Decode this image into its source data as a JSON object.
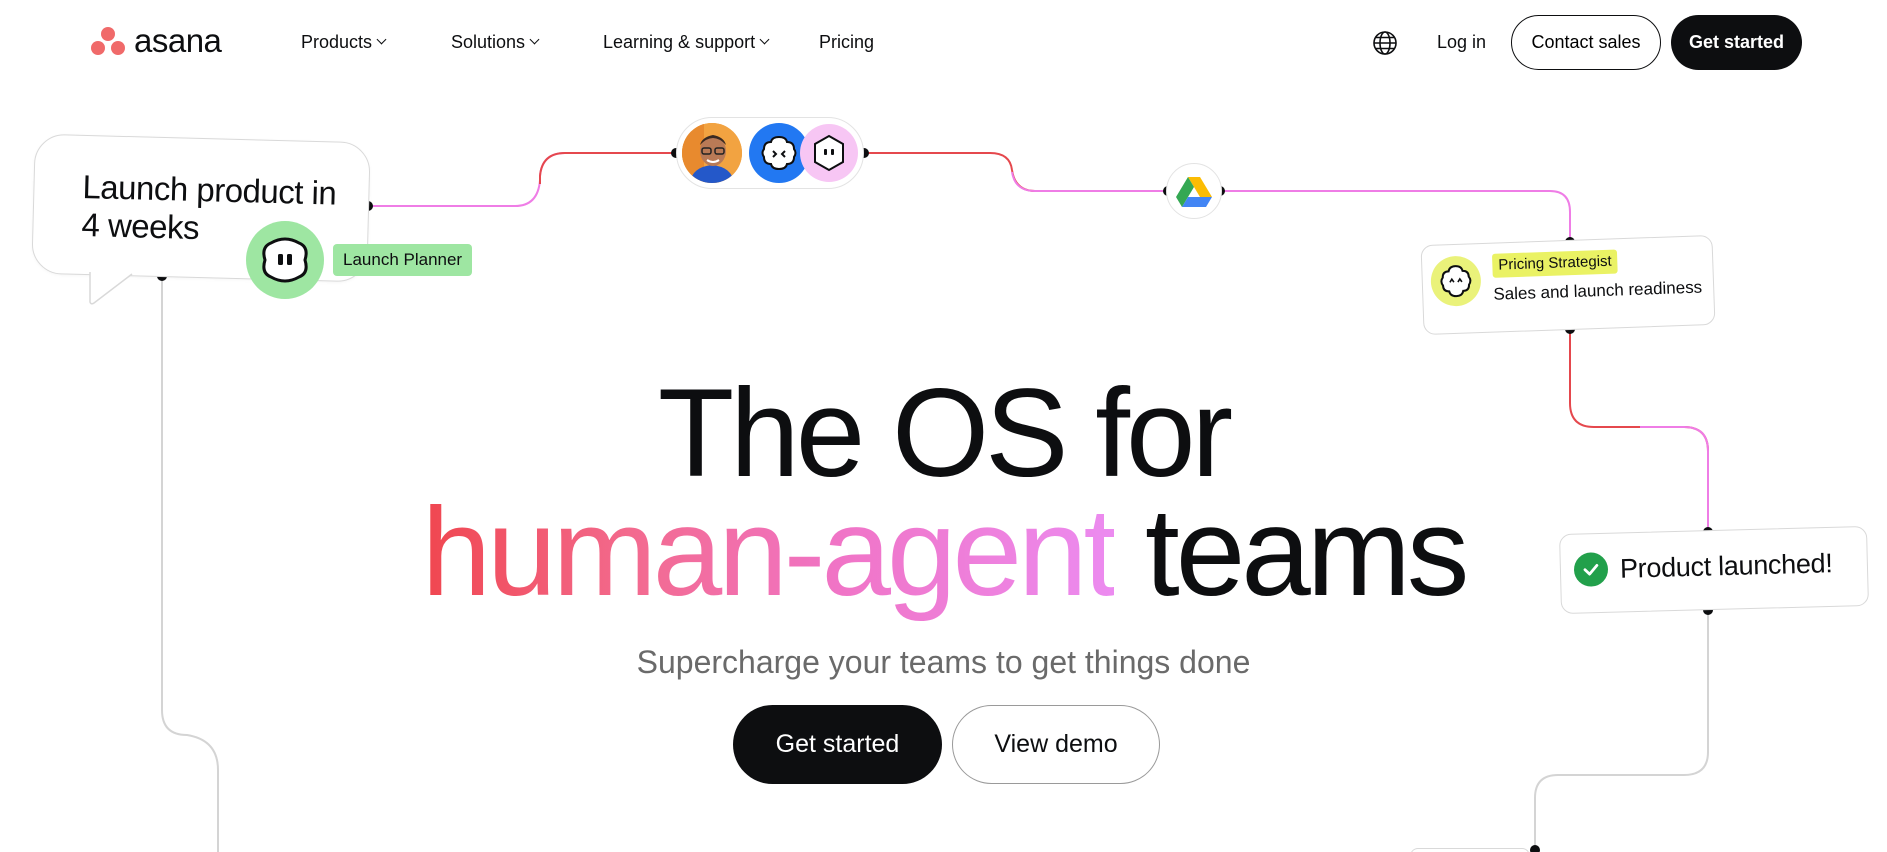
{
  "brand": {
    "name": "asana",
    "logo_color": "#f06a6a"
  },
  "nav": {
    "items": [
      {
        "label": "Products",
        "has_dropdown": true
      },
      {
        "label": "Solutions",
        "has_dropdown": true
      },
      {
        "label": "Learning & support",
        "has_dropdown": true
      },
      {
        "label": "Pricing",
        "has_dropdown": false
      }
    ],
    "language_icon": "globe-icon",
    "login": "Log in",
    "contact_sales": "Contact sales",
    "get_started": "Get started"
  },
  "flow": {
    "start_bubble": "Launch product in 4 weeks",
    "launch_planner_tag": "Launch Planner",
    "pricing_card": {
      "tag": "Pricing Strategist",
      "subtitle": "Sales and launch readiness"
    },
    "launched_card": "Product launched!",
    "colors": {
      "green_agent": "#9ee6a2",
      "yellow_agent": "#eaf264",
      "blue_agent": "#2278f2",
      "pink_agent": "#f7c6f4",
      "line_red": "#e5484d",
      "line_pink": "#ef7de6",
      "line_gray": "#d4d4d4"
    }
  },
  "hero": {
    "line1": "The OS for",
    "line2_gradient": "human-agent",
    "line2_rest": " teams",
    "subtitle": "Supercharge your teams to get things done",
    "primary_cta": "Get started",
    "secondary_cta": "View demo"
  }
}
